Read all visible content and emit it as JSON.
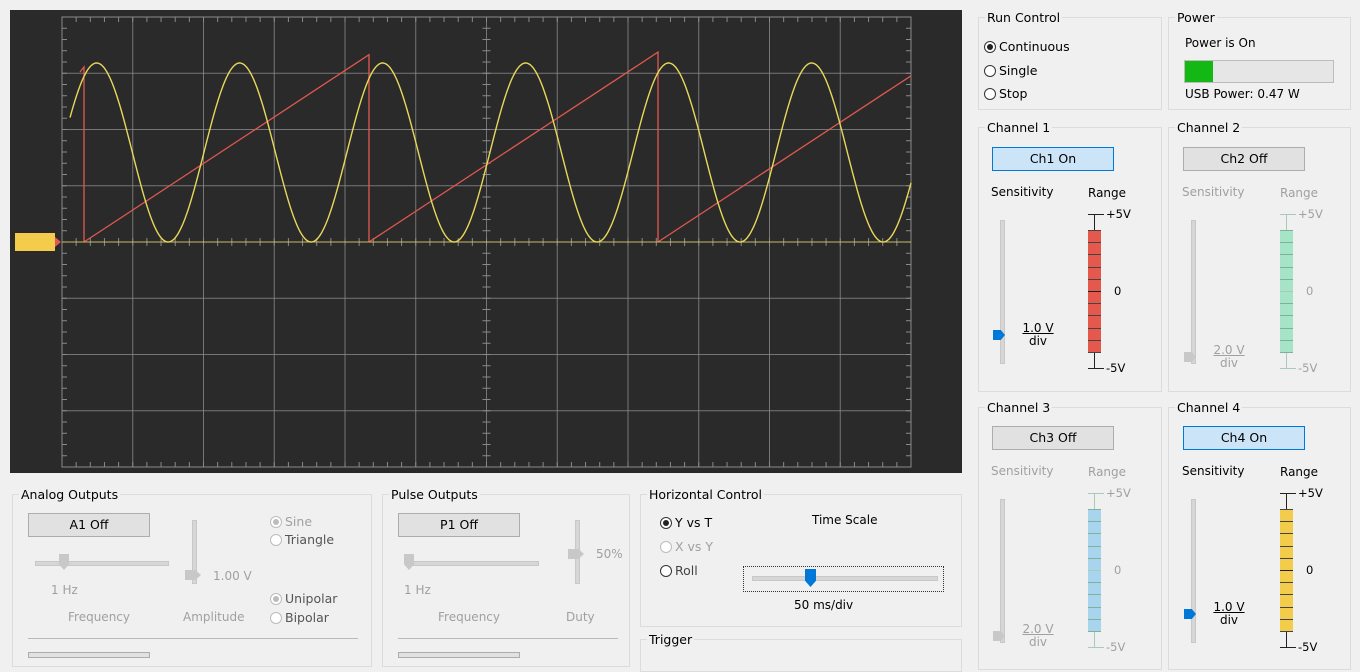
{
  "run_control": {
    "title": "Run Control",
    "options": [
      "Continuous",
      "Single",
      "Stop"
    ],
    "selected": "Continuous"
  },
  "power": {
    "title": "Power",
    "status": "Power is On",
    "usb": "USB Power: 0.47 W",
    "level": 0.19,
    "color": "#14b814"
  },
  "channel1": {
    "title": "Channel 1",
    "button": "Ch1 On",
    "sensitivity": "Sensitivity",
    "range": "Range",
    "value": "1.0 V",
    "unit": "div",
    "top": "+5V",
    "mid": "0",
    "bottom": "-5V",
    "color": "#e4584d",
    "enabled": true
  },
  "channel2": {
    "title": "Channel 2",
    "button": "Ch2 Off",
    "sensitivity": "Sensitivity",
    "range": "Range",
    "value": "2.0 V",
    "unit": "div",
    "top": "+5V",
    "mid": "0",
    "bottom": "-5V",
    "color": "#a6e4c8",
    "enabled": false
  },
  "channel3": {
    "title": "Channel 3",
    "button": "Ch3 Off",
    "sensitivity": "Sensitivity",
    "range": "Range",
    "value": "2.0 V",
    "unit": "div",
    "top": "+5V",
    "mid": "0",
    "bottom": "-5V",
    "color": "#a8d4ee",
    "enabled": false
  },
  "channel4": {
    "title": "Channel 4",
    "button": "Ch4 On",
    "sensitivity": "Sensitivity",
    "range": "Range",
    "value": "1.0 V",
    "unit": "div",
    "top": "+5V",
    "mid": "0",
    "bottom": "-5V",
    "color": "#f2cc4a",
    "enabled": true
  },
  "analog_outputs": {
    "title": "Analog Outputs",
    "button": "A1 Off",
    "frequency_value": "1 Hz",
    "frequency_label": "Frequency",
    "amplitude_value": "1.00 V",
    "amplitude_label": "Amplitude",
    "waveforms": [
      "Sine",
      "Triangle"
    ],
    "waveform_selected": "Sine",
    "polarity": [
      "Unipolar",
      "Bipolar"
    ],
    "polarity_selected": "Unipolar"
  },
  "pulse_outputs": {
    "title": "Pulse Outputs",
    "button": "P1 Off",
    "frequency_value": "1 Hz",
    "frequency_label": "Frequency",
    "duty_value": "50%",
    "duty_label": "Duty"
  },
  "horizontal_control": {
    "title": "Horizontal Control",
    "modes": [
      "Y vs T",
      "X vs Y",
      "Roll"
    ],
    "mode_selected": "Y vs T",
    "time_scale_label": "Time Scale",
    "time_scale_value": "50 ms/div"
  },
  "trigger": {
    "title": "Trigger"
  },
  "scope": {
    "background": "#2a2a2a",
    "grid_color": "#8a8a8a",
    "sine_color": "#e8d85a",
    "ramp_color": "#e0584e",
    "marker_color": "#f2cc4a"
  }
}
